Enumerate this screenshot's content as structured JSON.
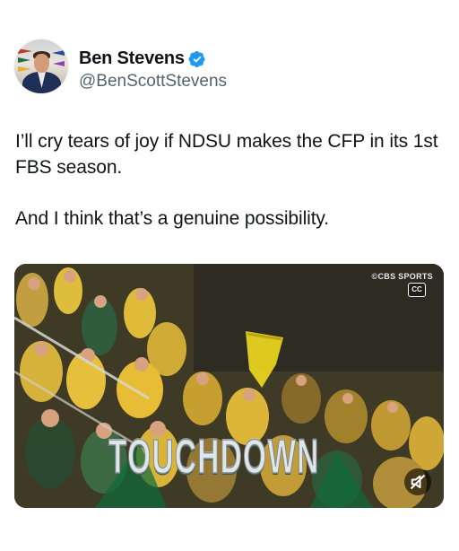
{
  "author": {
    "display_name": "Ben Stevens",
    "handle": "@BenScottStevens",
    "verified": true,
    "verified_color": "#1d9bf0"
  },
  "tweet": {
    "paragraph_1": "I’ll cry tears of joy if NDSU makes the CFP in its 1st FBS season.",
    "paragraph_2": "And I think that’s a genuine possibility."
  },
  "media": {
    "watermark": "©CBS SPORTS",
    "cc_label": "CC",
    "overlay_text": "TOUCHDOWN",
    "muted": true,
    "icons": [
      "closed-captions-icon",
      "muted-speaker-icon"
    ]
  },
  "colors": {
    "text_primary": "#0f1419",
    "text_secondary": "#536471",
    "ndsu_green": "#0a5640",
    "ndsu_gold": "#ffc82e"
  }
}
